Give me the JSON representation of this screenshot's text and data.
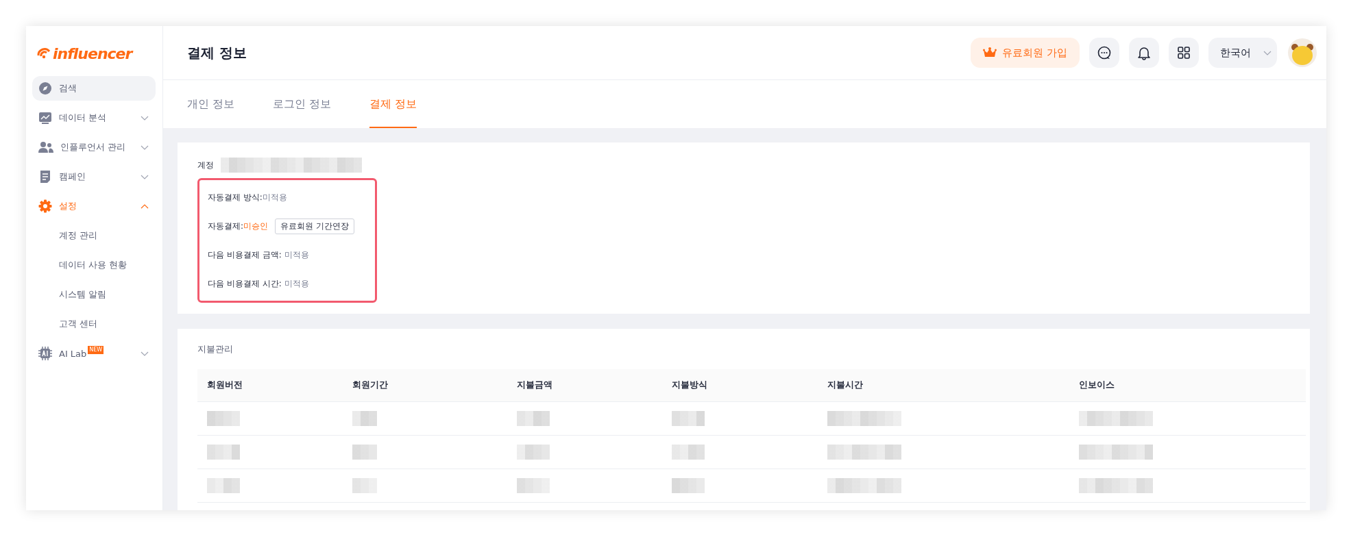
{
  "logo": {
    "text": "influencer"
  },
  "sidebar": {
    "items": [
      {
        "label": "검색",
        "selected": true,
        "expanded": false,
        "expandable": false
      },
      {
        "label": "데이터 분석",
        "selected": false,
        "expanded": false,
        "expandable": true
      },
      {
        "label": "인플루언서 관리",
        "selected": false,
        "expanded": false,
        "expandable": true
      },
      {
        "label": "캠페인",
        "selected": false,
        "expanded": false,
        "expandable": true
      },
      {
        "label": "설정",
        "selected": false,
        "expanded": true,
        "expandable": true,
        "children": [
          {
            "label": "계정 관리"
          },
          {
            "label": "데이터 사용 현황"
          },
          {
            "label": "시스템 알림"
          },
          {
            "label": "고객 센터"
          }
        ]
      },
      {
        "label": "AI Lab",
        "badge": "NEW",
        "selected": false,
        "expanded": false,
        "expandable": true
      }
    ]
  },
  "header": {
    "title": "결제 정보",
    "premium_button": "유료회원 가입",
    "language": "한국어"
  },
  "tabs": [
    {
      "label": "개인 정보",
      "selected": false
    },
    {
      "label": "로그인 정보",
      "selected": false
    },
    {
      "label": "결제 정보",
      "selected": true
    }
  ],
  "account": {
    "label": "계정",
    "value_blurred": true,
    "rows": [
      {
        "label": "자동결제 방식:",
        "value": "미적용",
        "alert": false
      },
      {
        "label": "자동결제:",
        "value": "미승인",
        "alert": true,
        "button": "유료회원 기간연장"
      },
      {
        "label": "다음 비용결제 금액: ",
        "value": "미적용",
        "alert": false
      },
      {
        "label": "다음 비용결제 시간: ",
        "value": "미적용",
        "alert": false
      }
    ]
  },
  "payments": {
    "title": "지불관리",
    "columns": [
      "회원버전",
      "회원기간",
      "지불금액",
      "지불방식",
      "지불시간",
      "인보이스"
    ],
    "rows": [
      {
        "blurred": true
      },
      {
        "blurred": true
      },
      {
        "blurred": true
      }
    ]
  }
}
